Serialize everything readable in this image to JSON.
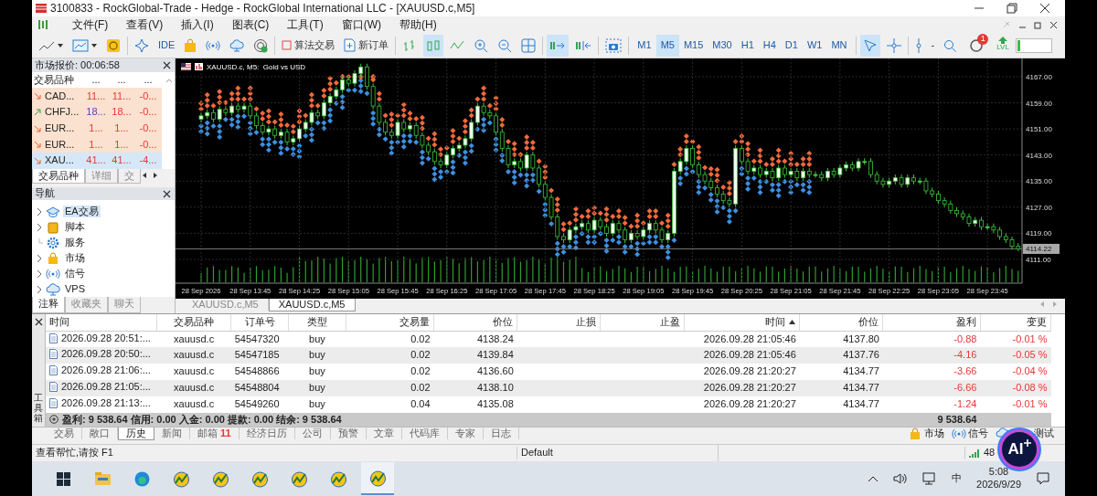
{
  "window": {
    "title": "3100833 - RockGlobal-Trade - Hedge - RockGlobal International LLC - [XAUUSD.c,M5]"
  },
  "menu": [
    "文件(F)",
    "查看(V)",
    "插入(I)",
    "图表(C)",
    "工具(T)",
    "窗口(W)",
    "帮助(H)"
  ],
  "toolbar": {
    "ide": "IDE",
    "algo_trading": "算法交易",
    "new_order": "新订单",
    "chart_types": [
      {
        "kind": "bars",
        "selected": false
      },
      {
        "kind": "candles",
        "selected": true
      },
      {
        "kind": "line",
        "selected": false
      }
    ],
    "auto_scroll": true,
    "chart_shift": false,
    "timeframes": [
      {
        "label": "M1",
        "selected": false
      },
      {
        "label": "M5",
        "selected": true
      },
      {
        "label": "M15",
        "selected": false
      },
      {
        "label": "M30",
        "selected": false
      },
      {
        "label": "H1",
        "selected": false
      },
      {
        "label": "H4",
        "selected": false
      },
      {
        "label": "D1",
        "selected": false
      },
      {
        "label": "W1",
        "selected": false
      },
      {
        "label": "MN",
        "selected": false
      }
    ],
    "tools": [
      {
        "kind": "cursor",
        "selected": true
      },
      {
        "kind": "crosshair",
        "selected": false
      }
    ],
    "separator_label": "-",
    "notification_count": "1",
    "level_label": "LVL",
    "level": 0.08
  },
  "market_watch": {
    "title": "市场报价: 00:06:58",
    "columns": [
      "交易品种",
      "...",
      "...",
      "..."
    ],
    "rows": [
      {
        "symbol": "CAD...",
        "bid": "11...",
        "ask": "11...",
        "change": "-0...",
        "rising": false,
        "selected": false
      },
      {
        "symbol": "CHFJ...",
        "bid": "18...",
        "ask": "18...",
        "change": "-0...",
        "rising": true,
        "selected": false
      },
      {
        "symbol": "EUR...",
        "bid": "1...",
        "ask": "1...",
        "change": "-0...",
        "rising": false,
        "selected": false
      },
      {
        "symbol": "EUR...",
        "bid": "1...",
        "ask": "1...",
        "change": "-0...",
        "rising": false,
        "selected": false
      },
      {
        "symbol": "XAU...",
        "bid": "41...",
        "ask": "41...",
        "change": "-4...",
        "rising": false,
        "selected": true
      }
    ],
    "tabs": [
      {
        "label": "交易品种",
        "selected": true
      },
      {
        "label": "详细",
        "selected": false
      },
      {
        "label": "交",
        "selected": false
      }
    ]
  },
  "navigator": {
    "title": "导航",
    "items": [
      {
        "label": "EA交易",
        "kind": "experts",
        "expandable": true,
        "selected": true
      },
      {
        "label": "脚本",
        "kind": "scripts",
        "expandable": true,
        "selected": false
      },
      {
        "label": "服务",
        "kind": "services",
        "expandable": false,
        "selected": false
      },
      {
        "label": "市场",
        "kind": "market",
        "expandable": true,
        "selected": false
      },
      {
        "label": "信号",
        "kind": "signals",
        "expandable": true,
        "selected": false
      },
      {
        "label": "VPS",
        "kind": "vps",
        "expandable": true,
        "selected": false
      }
    ],
    "tabs": [
      {
        "label": "注释",
        "selected": true
      },
      {
        "label": "收藏夹",
        "selected": false
      },
      {
        "label": "聊天",
        "selected": false
      }
    ]
  },
  "chart": {
    "title": "XAUUSD.c, M5:  Gold vs USD",
    "chart_data": {
      "type": "candlestick",
      "ylim": [
        4103.7,
        4172.6
      ],
      "grid": true,
      "ref_lines": [
        {
          "axis": "y",
          "value": 4114.22,
          "label": "4114.22"
        }
      ],
      "yticks": [
        {
          "value": 4167,
          "label": "4167.00"
        },
        {
          "value": 4159,
          "label": "4159.00"
        },
        {
          "value": 4151,
          "label": "4151.00"
        },
        {
          "value": 4143,
          "label": "4143.00"
        },
        {
          "value": 4135,
          "label": "4135.00"
        },
        {
          "value": 4127,
          "label": "4127.00"
        },
        {
          "value": 4119,
          "label": "4119.00"
        },
        {
          "value": 4111,
          "label": "4111.00"
        }
      ],
      "categories": [
        "28 Sep 2026",
        null,
        null,
        null,
        null,
        null,
        null,
        null,
        "28 Sep 13:45",
        null,
        null,
        null,
        null,
        null,
        null,
        null,
        "28 Sep 14:25",
        null,
        null,
        null,
        null,
        null,
        null,
        null,
        "28 Sep 15:05",
        null,
        null,
        null,
        null,
        null,
        null,
        null,
        "28 Sep 15:45",
        null,
        null,
        null,
        null,
        null,
        null,
        null,
        "28 Sep 16:25",
        null,
        null,
        null,
        null,
        null,
        null,
        null,
        "28 Sep 17:05",
        null,
        null,
        null,
        null,
        null,
        null,
        null,
        "28 Sep 17:45",
        null,
        null,
        null,
        null,
        null,
        null,
        null,
        "28 Sep 18:25",
        null,
        null,
        null,
        null,
        null,
        null,
        null,
        "28 Sep 19:05",
        null,
        null,
        null,
        null,
        null,
        null,
        null,
        "28 Sep 19:45",
        null,
        null,
        null,
        null,
        null,
        null,
        null,
        "28 Sep 20:25",
        null,
        null,
        null,
        null,
        null,
        null,
        null,
        "28 Sep 21:05",
        null,
        null,
        null,
        null,
        null,
        null,
        null,
        "28 Sep 21:45",
        null,
        null,
        null,
        null,
        null,
        null,
        null,
        "28 Sep 22:25",
        null,
        null,
        null,
        null,
        null,
        null,
        null,
        "28 Sep 23:05",
        null,
        null,
        null,
        null,
        null,
        null,
        null,
        "28 Sep 23:45",
        null,
        null,
        null,
        null,
        null
      ],
      "ohlc": [
        [
          4154,
          4156,
          4153,
          4155
        ],
        [
          4155,
          4157,
          4154,
          4156
        ],
        [
          4156,
          4157,
          4153,
          4154
        ],
        [
          4154,
          4158,
          4153,
          4157
        ],
        [
          4157,
          4158,
          4155,
          4156
        ],
        [
          4156,
          4159,
          4155,
          4158
        ],
        [
          4158,
          4159,
          4156,
          4157
        ],
        [
          4157,
          4159,
          4156,
          4158
        ],
        [
          4158,
          4159,
          4154,
          4155
        ],
        [
          4155,
          4156,
          4151,
          4152
        ],
        [
          4152,
          4153,
          4149,
          4150
        ],
        [
          4150,
          4152,
          4149,
          4151
        ],
        [
          4151,
          4152,
          4148,
          4149
        ],
        [
          4149,
          4151,
          4148,
          4150
        ],
        [
          4150,
          4151,
          4146,
          4147
        ],
        [
          4147,
          4149,
          4146,
          4148
        ],
        [
          4148,
          4152,
          4147,
          4151
        ],
        [
          4151,
          4154,
          4150,
          4153
        ],
        [
          4153,
          4157,
          4152,
          4156
        ],
        [
          4156,
          4157,
          4154,
          4155
        ],
        [
          4155,
          4160,
          4154,
          4159
        ],
        [
          4159,
          4162,
          4158,
          4161
        ],
        [
          4161,
          4164,
          4160,
          4163
        ],
        [
          4163,
          4167,
          4162,
          4166
        ],
        [
          4166,
          4167,
          4164,
          4165
        ],
        [
          4165,
          4169,
          4164,
          4168
        ],
        [
          4168,
          4171,
          4167,
          4170
        ],
        [
          4170,
          4171,
          4163,
          4164
        ],
        [
          4164,
          4165,
          4157,
          4158
        ],
        [
          4158,
          4159,
          4152,
          4153
        ],
        [
          4153,
          4154,
          4149,
          4150
        ],
        [
          4150,
          4151,
          4148,
          4149
        ],
        [
          4149,
          4154,
          4148,
          4153
        ],
        [
          4153,
          4154,
          4150,
          4151
        ],
        [
          4151,
          4153,
          4150,
          4152
        ],
        [
          4152,
          4153,
          4148,
          4149
        ],
        [
          4149,
          4150,
          4145,
          4146
        ],
        [
          4146,
          4147,
          4143,
          4144
        ],
        [
          4144,
          4145,
          4140,
          4141
        ],
        [
          4141,
          4142,
          4139,
          4140
        ],
        [
          4140,
          4144,
          4139,
          4143
        ],
        [
          4143,
          4146,
          4142,
          4145
        ],
        [
          4145,
          4147,
          4144,
          4146
        ],
        [
          4146,
          4149,
          4145,
          4148
        ],
        [
          4148,
          4154,
          4147,
          4153
        ],
        [
          4153,
          4159,
          4152,
          4158
        ],
        [
          4158,
          4159,
          4155,
          4156
        ],
        [
          4156,
          4157,
          4154,
          4155
        ],
        [
          4155,
          4156,
          4149,
          4150
        ],
        [
          4150,
          4151,
          4144,
          4145
        ],
        [
          4145,
          4146,
          4139,
          4140
        ],
        [
          4140,
          4142,
          4139,
          4141
        ],
        [
          4141,
          4142,
          4138,
          4139
        ],
        [
          4139,
          4144,
          4138,
          4143
        ],
        [
          4143,
          4144,
          4138,
          4139
        ],
        [
          4139,
          4140,
          4133,
          4134
        ],
        [
          4134,
          4135,
          4129,
          4130
        ],
        [
          4130,
          4131,
          4123,
          4124
        ],
        [
          4124,
          4125,
          4117,
          4118
        ],
        [
          4118,
          4119,
          4116,
          4117
        ],
        [
          4117,
          4121,
          4116,
          4120
        ],
        [
          4120,
          4122,
          4119,
          4121
        ],
        [
          4121,
          4123,
          4120,
          4122
        ],
        [
          4122,
          4123,
          4119,
          4120
        ],
        [
          4120,
          4124,
          4119,
          4123
        ],
        [
          4123,
          4124,
          4120,
          4121
        ],
        [
          4121,
          4122,
          4118,
          4119
        ],
        [
          4119,
          4123,
          4118,
          4122
        ],
        [
          4122,
          4123,
          4119,
          4120
        ],
        [
          4120,
          4121,
          4116,
          4117
        ],
        [
          4117,
          4120,
          4116,
          4119
        ],
        [
          4119,
          4120,
          4117,
          4118
        ],
        [
          4118,
          4121,
          4117,
          4120
        ],
        [
          4120,
          4123,
          4119,
          4122
        ],
        [
          4122,
          4123,
          4119,
          4120
        ],
        [
          4120,
          4121,
          4116,
          4117
        ],
        [
          4117,
          4120,
          4116,
          4119
        ],
        [
          4119,
          4139,
          4118,
          4138
        ],
        [
          4138,
          4142,
          4137,
          4141
        ],
        [
          4141,
          4146,
          4140,
          4145
        ],
        [
          4145,
          4146,
          4139,
          4140
        ],
        [
          4140,
          4141,
          4136,
          4137
        ],
        [
          4137,
          4138,
          4134,
          4135
        ],
        [
          4135,
          4136,
          4132,
          4133
        ],
        [
          4133,
          4134,
          4130,
          4131
        ],
        [
          4131,
          4132,
          4128,
          4129
        ],
        [
          4129,
          4130,
          4127,
          4128
        ],
        [
          4128,
          4146,
          4127,
          4145
        ],
        [
          4145,
          4146,
          4140,
          4141
        ],
        [
          4141,
          4142,
          4137,
          4138
        ],
        [
          4138,
          4140,
          4137,
          4139
        ],
        [
          4139,
          4140,
          4136,
          4137
        ],
        [
          4137,
          4139,
          4136,
          4138
        ],
        [
          4138,
          4139,
          4135,
          4136
        ],
        [
          4136,
          4140,
          4135,
          4139
        ],
        [
          4139,
          4140,
          4136,
          4137
        ],
        [
          4137,
          4139,
          4136,
          4138
        ],
        [
          4138,
          4139,
          4135,
          4136
        ],
        [
          4136,
          4139,
          4135,
          4138
        ],
        [
          4138,
          4139,
          4136,
          4137
        ],
        [
          4137,
          4138,
          4136,
          4137
        ],
        [
          4137,
          4138,
          4135,
          4136
        ],
        [
          4136,
          4139,
          4135,
          4138
        ],
        [
          4138,
          4139,
          4136,
          4137
        ],
        [
          4137,
          4140,
          4136,
          4139
        ],
        [
          4139,
          4141,
          4138,
          4140
        ],
        [
          4140,
          4141,
          4138,
          4139
        ],
        [
          4139,
          4142,
          4138,
          4141
        ],
        [
          4141,
          4142,
          4140,
          4141
        ],
        [
          4141,
          4142,
          4136,
          4137
        ],
        [
          4137,
          4138,
          4134,
          4135
        ],
        [
          4135,
          4136,
          4133,
          4134
        ],
        [
          4134,
          4136,
          4133,
          4135
        ],
        [
          4135,
          4137,
          4134,
          4136
        ],
        [
          4136,
          4137,
          4133,
          4134
        ],
        [
          4134,
          4137,
          4133,
          4136
        ],
        [
          4136,
          4137,
          4134,
          4135
        ],
        [
          4135,
          4136,
          4134,
          4135
        ],
        [
          4135,
          4136,
          4131,
          4132
        ],
        [
          4132,
          4133,
          4130,
          4131
        ],
        [
          4131,
          4132,
          4128,
          4129
        ],
        [
          4129,
          4130,
          4127,
          4128
        ],
        [
          4128,
          4129,
          4125,
          4126
        ],
        [
          4126,
          4127,
          4124,
          4125
        ],
        [
          4125,
          4126,
          4123,
          4124
        ],
        [
          4124,
          4125,
          4121,
          4122
        ],
        [
          4122,
          4124,
          4121,
          4123
        ],
        [
          4123,
          4124,
          4120,
          4121
        ],
        [
          4121,
          4122,
          4120,
          4121
        ],
        [
          4121,
          4122,
          4119,
          4120
        ],
        [
          4120,
          4121,
          4117,
          4118
        ],
        [
          4118,
          4119,
          4116,
          4117
        ],
        [
          4117,
          4118,
          4114,
          4115
        ],
        [
          4115,
          4116,
          4113.5,
          4114.22
        ]
      ]
    }
  },
  "chart_tabs": [
    {
      "label": "XAUUSD.c,M5",
      "selected": false
    },
    {
      "label": "XAUUSD.c,M5",
      "selected": true
    }
  ],
  "toolbox": {
    "title": "工具箱",
    "columns": [
      {
        "label": "时间",
        "sorted": false
      },
      {
        "label": "交易品种",
        "sorted": false
      },
      {
        "label": "订单号",
        "sorted": false
      },
      {
        "label": "类型",
        "sorted": false
      },
      {
        "label": "交易量",
        "sorted": false
      },
      {
        "label": "价位",
        "sorted": false
      },
      {
        "label": "止损",
        "sorted": false
      },
      {
        "label": "止盈",
        "sorted": false
      },
      {
        "label": "时间",
        "sorted": true
      },
      {
        "label": "价位",
        "sorted": false
      },
      {
        "label": "盈利",
        "sorted": false
      },
      {
        "label": "变更",
        "sorted": false
      }
    ],
    "rows": [
      {
        "open_time": "2026.09.28 20:51:...",
        "symbol": "xauusd.c",
        "ticket": "54547320",
        "type": "buy",
        "volume": "0.02",
        "open_price": "4138.24",
        "close_time": "2026.09.28 21:05:46",
        "close_price": "4137.80",
        "profit": "-0.88",
        "change": "-0.01 %",
        "loss": true
      },
      {
        "open_time": "2026.09.28 20:50:...",
        "symbol": "xauusd.c",
        "ticket": "54547185",
        "type": "buy",
        "volume": "0.02",
        "open_price": "4139.84",
        "close_time": "2026.09.28 21:05:46",
        "close_price": "4137.76",
        "profit": "-4.16",
        "change": "-0.05 %",
        "loss": true
      },
      {
        "open_time": "2026.09.28 21:06:...",
        "symbol": "xauusd.c",
        "ticket": "54548866",
        "type": "buy",
        "volume": "0.02",
        "open_price": "4136.60",
        "close_time": "2026.09.28 21:20:27",
        "close_price": "4134.77",
        "profit": "-3.66",
        "change": "-0.04 %",
        "loss": true
      },
      {
        "open_time": "2026.09.28 21:05:...",
        "symbol": "xauusd.c",
        "ticket": "54548804",
        "type": "buy",
        "volume": "0.02",
        "open_price": "4138.10",
        "close_time": "2026.09.28 21:20:27",
        "close_price": "4134.77",
        "profit": "-6.66",
        "change": "-0.08 %",
        "loss": true
      },
      {
        "open_time": "2026.09.28 21:13:...",
        "symbol": "xauusd.c",
        "ticket": "54549260",
        "type": "buy",
        "volume": "0.04",
        "open_price": "4135.08",
        "close_time": "2026.09.28 21:20:27",
        "close_price": "4134.77",
        "profit": "-1.24",
        "change": "-0.01 %",
        "loss": true
      }
    ],
    "summary": {
      "text": "盈利: 9 538.64  信用: 0.00  入金: 0.00  提款: 0.00  结余: 9 538.64",
      "profit": "9 538.64"
    },
    "tabs": [
      {
        "label": "交易",
        "selected": false
      },
      {
        "label": "敞口",
        "selected": false
      },
      {
        "label": "历史",
        "selected": true
      },
      {
        "label": "新闻",
        "selected": false
      },
      {
        "label": "邮箱",
        "badge": "11",
        "selected": false
      },
      {
        "label": "经济日历",
        "selected": false
      },
      {
        "label": "公司",
        "selected": false
      },
      {
        "label": "预警",
        "selected": false
      },
      {
        "label": "文章",
        "selected": false
      },
      {
        "label": "代码库",
        "selected": false
      },
      {
        "label": "专家",
        "selected": false
      },
      {
        "label": "日志",
        "selected": false
      }
    ],
    "shortcuts": [
      {
        "label": "市场",
        "kind": "market"
      },
      {
        "label": "信号",
        "kind": "signals"
      },
      {
        "kind": "vps"
      },
      {
        "label": "测试",
        "kind": "tester"
      }
    ]
  },
  "status_bar": {
    "help": "查看帮忙,请按 F1",
    "profile": "Default",
    "signal": "48"
  },
  "assistant": {
    "label": "AI"
  },
  "taskbar": {
    "apps": [
      {
        "kind": "start",
        "active": false
      },
      {
        "kind": "explorer",
        "active": false
      },
      {
        "kind": "browser",
        "active": false
      },
      {
        "kind": "terminal",
        "active": false
      },
      {
        "kind": "terminal",
        "active": false
      },
      {
        "kind": "terminal",
        "active": false
      },
      {
        "kind": "terminal",
        "active": false
      },
      {
        "kind": "terminal",
        "active": false
      },
      {
        "kind": "terminal",
        "active": true
      }
    ],
    "ime": "中",
    "time": "5:08",
    "date": "2026/9/29"
  }
}
